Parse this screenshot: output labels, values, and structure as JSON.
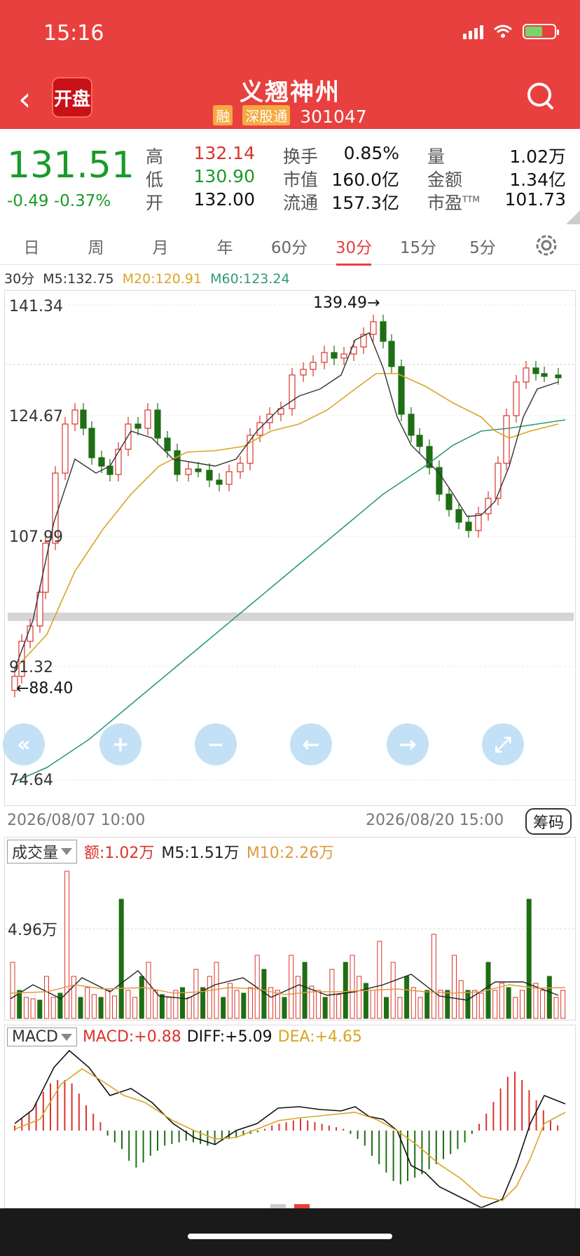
{
  "status_bar": {
    "time": "15:16"
  },
  "header": {
    "logo_text": "开盘",
    "stock_name": "义翘神州",
    "tag_margin": "融",
    "tag_connect": "深股通",
    "stock_code": "301047"
  },
  "quote": {
    "price": "131.51",
    "change": "-0.49 -0.37%",
    "high_label": "高",
    "high": "132.14",
    "low_label": "低",
    "low": "130.90",
    "open_label": "开",
    "open": "132.00",
    "turnover_label": "换手",
    "turnover": "0.85%",
    "mcap_label": "市值",
    "mcap": "160.0亿",
    "float_label": "流通",
    "float": "157.3亿",
    "volume_label": "量",
    "volume": "1.02万",
    "amount_label": "金额",
    "amount": "1.34亿",
    "pe_label": "市盈",
    "pe_sup": "TTM",
    "pe": "101.73"
  },
  "tabs": [
    "日",
    "周",
    "月",
    "年",
    "60分",
    "30分",
    "15分",
    "5分"
  ],
  "active_tab": "30分",
  "ma_legend": {
    "period": "30分",
    "m5": "M5:132.75",
    "m20": "M20:120.91",
    "m60": "M60:123.24"
  },
  "chart": {
    "y_labels": [
      "141.34",
      "124.67",
      "107.99",
      "91.32",
      "74.64"
    ],
    "high_annot": "139.49→",
    "low_annot": "←88.40",
    "start_date": "2026/08/07 10:00",
    "end_date": "2026/08/20 15:00",
    "chips_label": "筹码",
    "nav_buttons": [
      "«",
      "+",
      "−",
      "←",
      "→",
      "⤢"
    ]
  },
  "volume": {
    "selector": "成交量",
    "amount": "额:1.02万",
    "m5": "M5:1.51万",
    "m10": "M10:2.26万",
    "y_label": "4.96万"
  },
  "macd": {
    "selector": "MACD",
    "macd": "MACD:+0.88",
    "diff": "DIFF:+5.09",
    "dea": "DEA:+4.65"
  },
  "colors": {
    "up": "#d9342b",
    "down": "#1e6e14",
    "header": "#e8403e",
    "m5": "#333333",
    "m20": "#d9a526",
    "m60": "#2f9a78"
  }
}
